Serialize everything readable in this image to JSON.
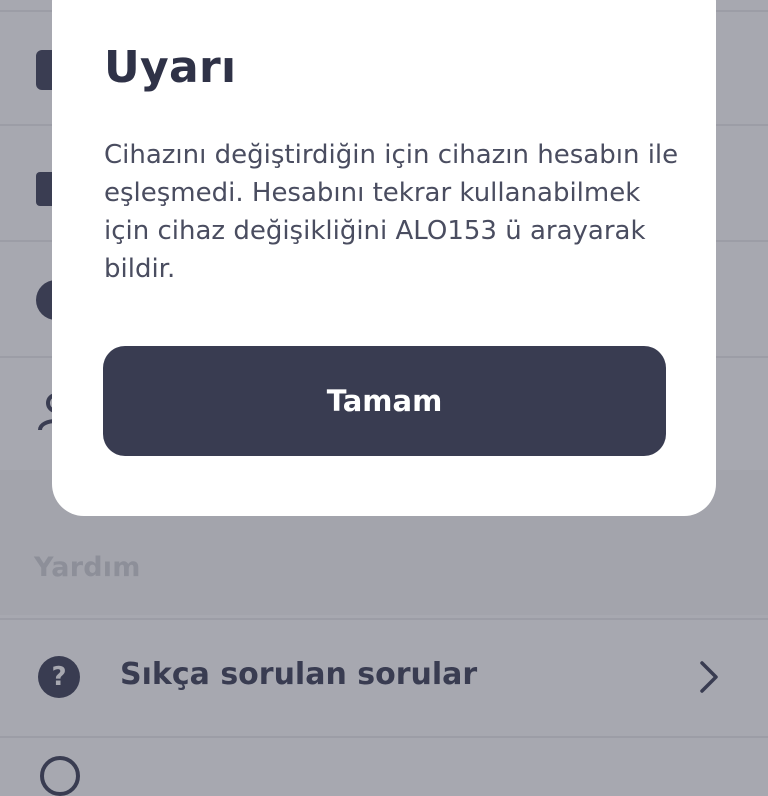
{
  "modal": {
    "title": "Uyarı",
    "message": "Cihazını değiştirdiğin için cihazın hesabın ile eşleşmedi. Hesabını tekrar kullanabilmek için cihaz değişikliğini ALO153 ü arayarak bildir.",
    "confirm_label": "Tamam"
  },
  "background": {
    "section_label": "Yardım",
    "faq_item": {
      "icon": "question-circle-icon",
      "label": "Sıkça sorulan sorular",
      "chevron": "chevron-right-icon"
    }
  },
  "colors": {
    "overlay_bg": "#a7a8b0",
    "modal_bg": "#ffffff",
    "primary": "#393c51",
    "title_text": "#2f3247",
    "body_text": "#4a4d60"
  }
}
